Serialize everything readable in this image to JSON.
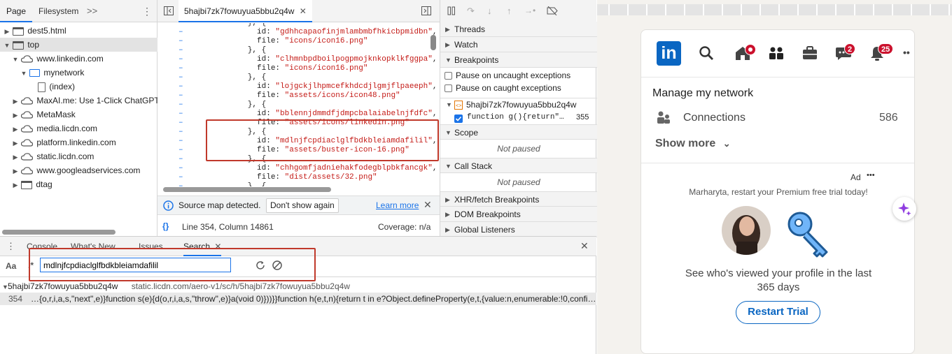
{
  "navigator": {
    "tabs": [
      "Page",
      "Filesystem"
    ],
    "more": ">>",
    "tree": [
      {
        "label": "dest5.html",
        "icon": "frame-icon",
        "tri": "▶",
        "indent": 0
      },
      {
        "label": "top",
        "icon": "frame-icon",
        "tri": "▼",
        "indent": 0,
        "selected": true
      },
      {
        "label": "www.linkedin.com",
        "icon": "cloud-icon",
        "tri": "▼",
        "indent": 1
      },
      {
        "label": "mynetwork",
        "icon": "folder-icon",
        "tri": "▼",
        "indent": 2
      },
      {
        "label": "(index)",
        "icon": "file-icon",
        "tri": "",
        "indent": 3
      },
      {
        "label": "MaxAI.me: Use 1-Click ChatGPT",
        "icon": "cloud-icon",
        "tri": "▶",
        "indent": 1
      },
      {
        "label": "MetaMask",
        "icon": "cloud-icon",
        "tri": "▶",
        "indent": 1
      },
      {
        "label": "media.licdn.com",
        "icon": "cloud-icon",
        "tri": "▶",
        "indent": 1
      },
      {
        "label": "platform.linkedin.com",
        "icon": "cloud-icon",
        "tri": "▶",
        "indent": 1
      },
      {
        "label": "static.licdn.com",
        "icon": "cloud-icon",
        "tri": "▶",
        "indent": 1
      },
      {
        "label": "www.googleadservices.com",
        "icon": "cloud-icon",
        "tri": "▶",
        "indent": 1
      },
      {
        "label": "dtag",
        "icon": "frame-icon",
        "tri": "▶",
        "indent": 1
      }
    ]
  },
  "source": {
    "tab_label": "5hajbi7zk7fowuyua5bbu2q4w",
    "code_lines": [
      {
        "dash": "–",
        "pre": "        }, {",
        "str": "",
        "post": ""
      },
      {
        "dash": "–",
        "pre": "          id: ",
        "str": "\"gdhhcapaofinjmlambmbfhkicbpmidbn\"",
        "post": ","
      },
      {
        "dash": "–",
        "pre": "          file: ",
        "str": "\"icons/icon16.png\"",
        "post": ""
      },
      {
        "dash": "–",
        "pre": "        }, {",
        "str": "",
        "post": ""
      },
      {
        "dash": "–",
        "pre": "          id: ",
        "str": "\"clhmnbpdboilpogpmojknkopklkfggpa\"",
        "post": ","
      },
      {
        "dash": "–",
        "pre": "          file: ",
        "str": "\"icons/icon16.png\"",
        "post": ""
      },
      {
        "dash": "–",
        "pre": "        }, {",
        "str": "",
        "post": ""
      },
      {
        "dash": "–",
        "pre": "          id: ",
        "str": "\"lojgckjlhpmcefkhdcdjlgmjflpaeeph\"",
        "post": ","
      },
      {
        "dash": "–",
        "pre": "          file: ",
        "str": "\"assets/icons/icon48.png\"",
        "post": ""
      },
      {
        "dash": "–",
        "pre": "        }, {",
        "str": "",
        "post": ""
      },
      {
        "dash": "–",
        "pre": "          id: ",
        "str": "\"bblennjdmmdfjdmpcbalaiabelnjfdfc\"",
        "post": ","
      },
      {
        "dash": "–",
        "pre": "          file: ",
        "str": "\"assets/icons/linkedin.png\"",
        "post": ""
      },
      {
        "dash": "–",
        "pre": "        }, {",
        "str": "",
        "post": ""
      },
      {
        "dash": "–",
        "pre": "          id: ",
        "str": "\"mdlnjfcpdiaclglfbdkbleiamdafilil\"",
        "post": ","
      },
      {
        "dash": "–",
        "pre": "          file: ",
        "str": "\"assets/buster-icon-16.png\"",
        "post": ""
      },
      {
        "dash": "–",
        "pre": "        }, {",
        "str": "",
        "post": ""
      },
      {
        "dash": "–",
        "pre": "          id: ",
        "str": "\"chhgomfjadniehakfodegblpbkfancgk\"",
        "post": ","
      },
      {
        "dash": "–",
        "pre": "          file: ",
        "str": "\"dist/assets/32.png\"",
        "post": ""
      },
      {
        "dash": "–",
        "pre": "        }, {",
        "str": "",
        "post": ""
      }
    ],
    "infobar": {
      "message": "Source map detected.",
      "dont_show": "Don't show again",
      "learn_more": "Learn more"
    },
    "status": {
      "position": "Line 354, Column 14861",
      "coverage": "Coverage: n/a"
    }
  },
  "debugger": {
    "sections": {
      "threads": "Threads",
      "watch": "Watch",
      "breakpoints": "Breakpoints",
      "scope": "Scope",
      "call_stack": "Call Stack",
      "xhr": "XHR/fetch Breakpoints",
      "dom": "DOM Breakpoints",
      "global": "Global Listeners"
    },
    "pause_uncaught": "Pause on uncaught exceptions",
    "pause_caught": "Pause on caught exceptions",
    "bp_file": "5hajbi7zk7fowuyua5bbu2q4w",
    "bp_code": "function g(){return\"…",
    "bp_line": "355",
    "not_paused": "Not paused"
  },
  "drawer": {
    "tabs": [
      "Console",
      "What's New",
      "Issues",
      "Search"
    ],
    "aa_label": "Aa",
    "regex_label": ".*",
    "search_value": "mdlnjfcpdiaclglfbdkbleiamdafilil",
    "result_file": "5hajbi7zk7fowuyua5bbu2q4w",
    "result_url": "static.licdn.com/aero-v1/sc/h/5hajbi7zk7fowuyua5bbu2q4w",
    "result_line_no": "354",
    "result_text": "…{o,r,i,a,s,\"next\",e)}function s(e){d(o,r,i,a,s,\"throw\",e)}a(void 0)}))}}function h(e,t,n){return t in e?Object.defineProperty(e,t,{value:n,enumerable:!0,confi…"
  },
  "linkedin": {
    "logo": "in",
    "badges": {
      "home": "",
      "messaging": "2",
      "notifications": "25"
    },
    "network_title": "Manage my network",
    "connections_label": "Connections",
    "connections_count": "586",
    "show_more": "Show more",
    "ad_label": "Ad",
    "ad_dots": "•••",
    "premium_msg": "Marharyta, restart your Premium free trial today!",
    "profile_views": "See who's viewed your profile in the last 365 days",
    "restart_button": "Restart Trial",
    "colors": {
      "brand": "#0a66c2",
      "badge": "#cb112d"
    }
  }
}
